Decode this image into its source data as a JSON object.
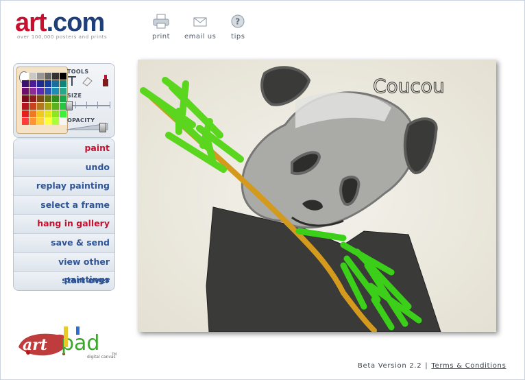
{
  "brand": {
    "logo_part1": "art",
    "logo_dot": ".",
    "logo_part2": "com",
    "tagline": "over 100,000 posters and prints"
  },
  "top_tools": [
    {
      "label": "print",
      "icon": "printer-icon"
    },
    {
      "label": "email us",
      "icon": "envelope-icon"
    },
    {
      "label": "tips",
      "icon": "question-icon"
    }
  ],
  "panel": {
    "tools_label": "TOOLS",
    "size_label": "SIZE",
    "opacity_label": "OPACITY",
    "tool_icons": [
      "text-tool-icon",
      "eraser-icon",
      "paint-tube-icon"
    ]
  },
  "palette_colors": [
    "#ffffff",
    "#c8c8c8",
    "#969696",
    "#646464",
    "#323232",
    "#000000",
    "#3a0f6e",
    "#4b1c99",
    "#1f2b8f",
    "#153d99",
    "#1a6e9e",
    "#12837a",
    "#6e0f6e",
    "#8c2c99",
    "#5a2cb3",
    "#2c54b3",
    "#1e8fb3",
    "#2aa68c",
    "#7a0a1e",
    "#8c1c1c",
    "#7a4a14",
    "#5a6e14",
    "#2c8c1c",
    "#1aa64a",
    "#b3141e",
    "#c8421c",
    "#b3781e",
    "#a6a614",
    "#5ab31e",
    "#23c83c",
    "#e61e1e",
    "#f0781e",
    "#f0c81e",
    "#e6e61e",
    "#8ce61e",
    "#3cf03c",
    "#ff3c3c",
    "#ff9632",
    "#ffd23c",
    "#ffff3c",
    "#aaff3c",
    "#f5f5f5"
  ],
  "menu": [
    {
      "label": "paint",
      "accent": true
    },
    {
      "label": "undo",
      "accent": false
    },
    {
      "label": "replay painting",
      "accent": false
    },
    {
      "label": "select a frame",
      "accent": false
    },
    {
      "label": "hang in gallery",
      "accent": true
    },
    {
      "label": "save & send",
      "accent": false
    },
    {
      "label": "view other paintings",
      "accent": false
    },
    {
      "label": "start over",
      "accent": false
    }
  ],
  "canvas": {
    "handwritten_text": "Coucou"
  },
  "artpad": {
    "logo_text": "artpad",
    "subtitle": "digital canvas",
    "tm": "TM"
  },
  "footer": {
    "version": "Beta Version 2.2",
    "separator": "|",
    "terms": "Terms & Conditions"
  },
  "colors": {
    "brand_red": "#c8102e",
    "brand_blue": "#1f3f7a",
    "menu_blue": "#2f5597",
    "menu_red": "#c8102e"
  }
}
